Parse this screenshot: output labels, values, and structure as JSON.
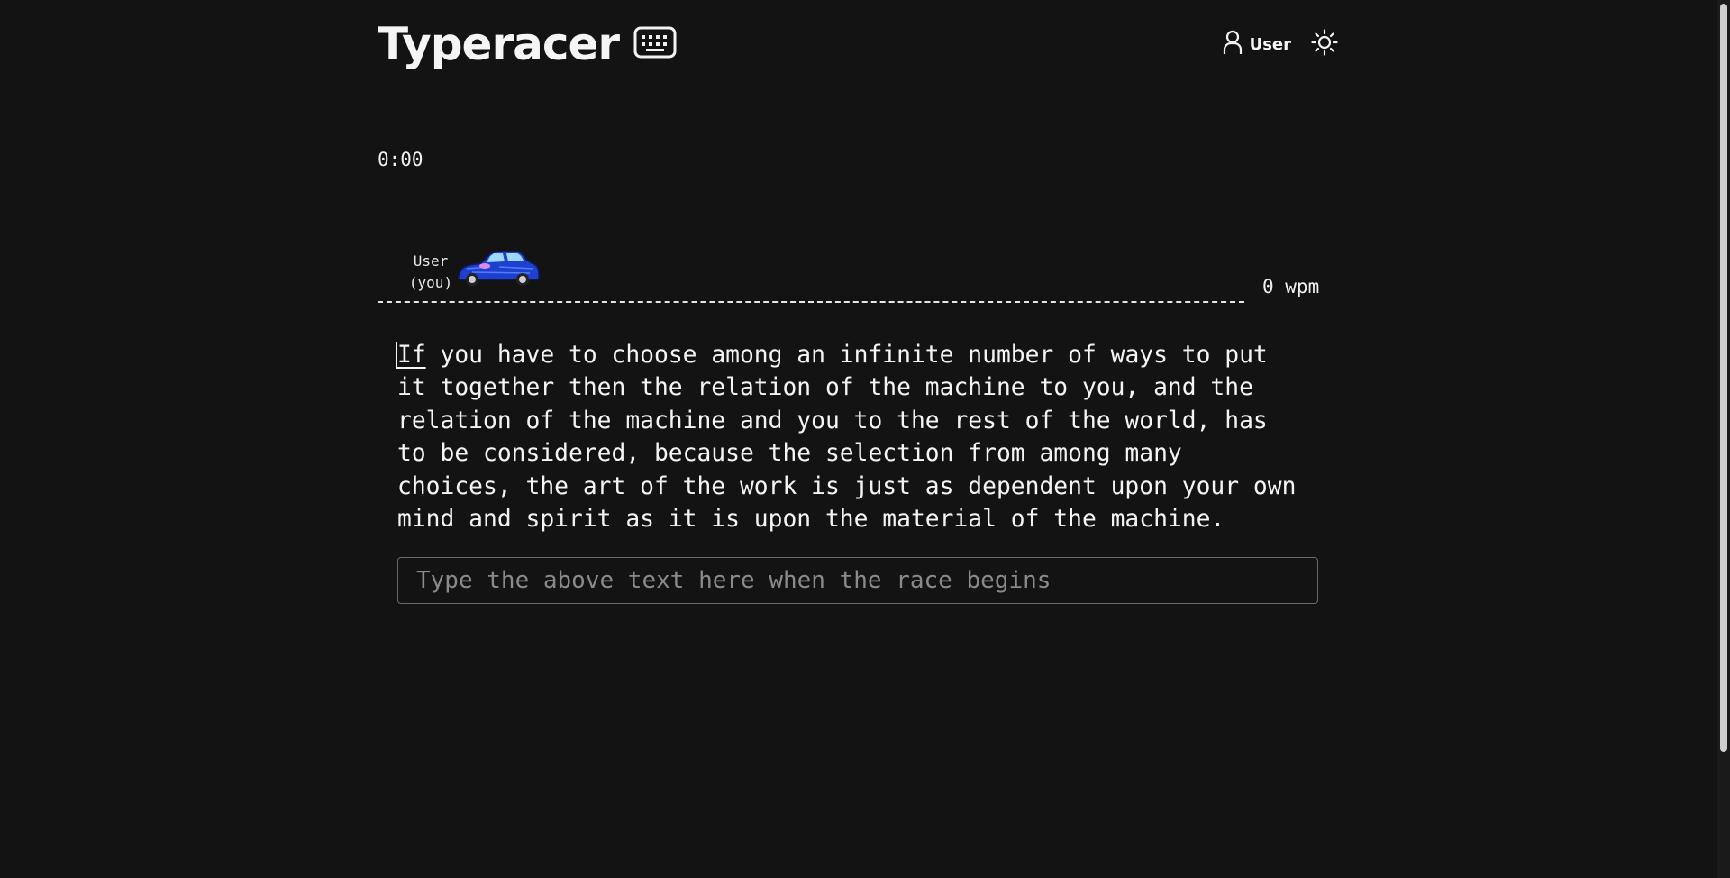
{
  "header": {
    "title": "Typeracer",
    "user_label": "User"
  },
  "race": {
    "timer": "0:00",
    "racer": {
      "name": "User",
      "tag": "(you)",
      "wpm": "0 wpm",
      "progress": 0
    },
    "passage": {
      "current_word": "If",
      "rest": " you have to choose among an infinite number of ways to put it together then the relation of the machine to you, and the relation of the machine and you to the rest of the world, has to be considered, because the selection from among many choices, the art of the work is just as dependent upon your own mind and spirit as it is upon the material of the machine."
    },
    "input": {
      "value": "",
      "placeholder": "Type the above text here when the race begins"
    }
  },
  "icons": {
    "keyboard": "keyboard-icon",
    "user": "user-icon",
    "theme": "sun-icon",
    "car": "car-icon"
  },
  "colors": {
    "background": "#131313",
    "text": "#f4f4f4",
    "placeholder": "#8a8a8a",
    "car_body": "#1f3fcf"
  }
}
